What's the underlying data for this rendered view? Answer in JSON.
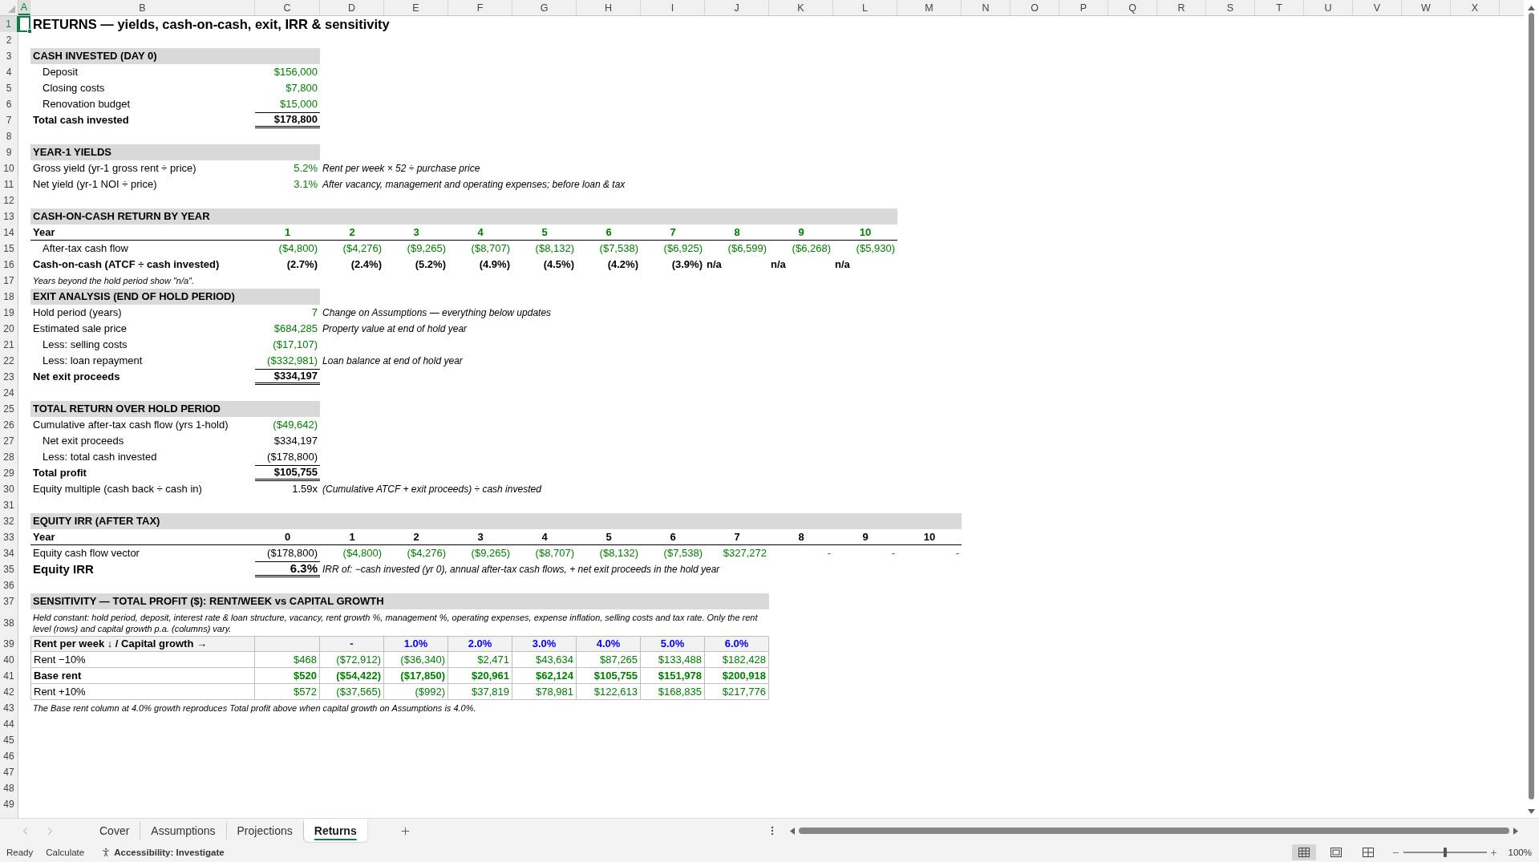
{
  "columns": [
    {
      "label": "A",
      "selected": true
    },
    {
      "label": "B",
      "selected": false
    },
    {
      "label": "C",
      "selected": false
    },
    {
      "label": "D",
      "selected": false
    },
    {
      "label": "E",
      "selected": false
    },
    {
      "label": "F",
      "selected": false
    },
    {
      "label": "G",
      "selected": false
    },
    {
      "label": "H",
      "selected": false
    },
    {
      "label": "I",
      "selected": false
    },
    {
      "label": "J",
      "selected": false
    },
    {
      "label": "K",
      "selected": false
    },
    {
      "label": "L",
      "selected": false
    },
    {
      "label": "M",
      "selected": false
    },
    {
      "label": "N",
      "selected": false
    },
    {
      "label": "O",
      "selected": false
    },
    {
      "label": "P",
      "selected": false
    },
    {
      "label": "Q",
      "selected": false
    },
    {
      "label": "R",
      "selected": false
    },
    {
      "label": "S",
      "selected": false
    },
    {
      "label": "T",
      "selected": false
    },
    {
      "label": "U",
      "selected": false
    },
    {
      "label": "V",
      "selected": false
    },
    {
      "label": "W",
      "selected": false
    },
    {
      "label": "X",
      "selected": false
    }
  ],
  "row_numbers": [
    {
      "label": "1",
      "selected": true
    },
    {
      "label": "2",
      "selected": false
    },
    {
      "label": "3",
      "selected": false
    },
    {
      "label": "4",
      "selected": false
    },
    {
      "label": "5",
      "selected": false
    },
    {
      "label": "6",
      "selected": false
    },
    {
      "label": "7",
      "selected": false
    },
    {
      "label": "8",
      "selected": false
    },
    {
      "label": "9",
      "selected": false
    },
    {
      "label": "10",
      "selected": false
    },
    {
      "label": "11",
      "selected": false
    },
    {
      "label": "12",
      "selected": false
    },
    {
      "label": "13",
      "selected": false
    },
    {
      "label": "14",
      "selected": false
    },
    {
      "label": "15",
      "selected": false
    },
    {
      "label": "16",
      "selected": false
    },
    {
      "label": "17",
      "selected": false
    },
    {
      "label": "18",
      "selected": false
    },
    {
      "label": "19",
      "selected": false
    },
    {
      "label": "20",
      "selected": false
    },
    {
      "label": "21",
      "selected": false
    },
    {
      "label": "22",
      "selected": false
    },
    {
      "label": "23",
      "selected": false
    },
    {
      "label": "24",
      "selected": false
    },
    {
      "label": "25",
      "selected": false
    },
    {
      "label": "26",
      "selected": false
    },
    {
      "label": "27",
      "selected": false
    },
    {
      "label": "28",
      "selected": false
    },
    {
      "label": "29",
      "selected": false
    },
    {
      "label": "30",
      "selected": false
    },
    {
      "label": "31",
      "selected": false
    },
    {
      "label": "32",
      "selected": false
    },
    {
      "label": "33",
      "selected": false
    },
    {
      "label": "34",
      "selected": false
    },
    {
      "label": "35",
      "selected": false
    },
    {
      "label": "36",
      "selected": false
    },
    {
      "label": "37",
      "selected": false
    },
    {
      "label": "38",
      "selected": false
    },
    {
      "label": "39",
      "selected": false
    },
    {
      "label": "40",
      "selected": false
    },
    {
      "label": "41",
      "selected": false
    },
    {
      "label": "42",
      "selected": false
    },
    {
      "label": "43",
      "selected": false
    },
    {
      "label": "44",
      "selected": false
    },
    {
      "label": "45",
      "selected": false
    },
    {
      "label": "46",
      "selected": false
    },
    {
      "label": "47",
      "selected": false
    },
    {
      "label": "48",
      "selected": false
    },
    {
      "label": "49",
      "selected": false
    }
  ],
  "title": "RETURNS — yields, cash-on-cash, exit, IRR & sensitivity",
  "cash_invested": {
    "heading": "CASH INVESTED (DAY 0)",
    "lines": [
      {
        "kind": "sub",
        "label": "Deposit",
        "value": "$156,000",
        "color": "#008000"
      },
      {
        "kind": "sub",
        "label": "Closing costs",
        "value": "$7,800",
        "color": "#008000"
      },
      {
        "kind": "sub",
        "label": "Renovation budget",
        "value": "$15,000",
        "color": "#008000"
      },
      {
        "kind": "total",
        "label": "Total cash invested",
        "value": "$178,800",
        "color": "#000000"
      }
    ]
  },
  "year1_yields": {
    "heading": "YEAR-1 YIELDS",
    "lines": [
      {
        "kind": "item",
        "label": "Gross yield (yr-1 gross rent ÷ price)",
        "value": "5.2%",
        "color": "#008000",
        "note": "Rent per week × 52 ÷ purchase price"
      },
      {
        "kind": "item",
        "label": "Net yield (yr-1 NOI ÷ price)",
        "value": "3.1%",
        "color": "#008000",
        "note": "After vacancy, management and operating expenses; before loan & tax"
      }
    ]
  },
  "cash_on_cash": {
    "heading": "CASH-ON-CASH RETURN BY YEAR",
    "year_label": "Year",
    "years": [
      "1",
      "2",
      "3",
      "4",
      "5",
      "6",
      "7",
      "8",
      "9",
      "10"
    ],
    "after_tax_cash_flow": {
      "label": "After-tax cash flow",
      "values": [
        "($4,800)",
        "($4,276)",
        "($9,265)",
        "($8,707)",
        "($8,132)",
        "($7,538)",
        "($6,925)",
        "($6,599)",
        "($6,268)",
        "($5,930)"
      ]
    },
    "cash_on_cash_return": {
      "label": "Cash-on-cash (ATCF ÷ cash invested)",
      "values": [
        "(2.7%)",
        "(2.4%)",
        "(5.2%)",
        "(4.9%)",
        "(4.5%)",
        "(4.2%)",
        "(3.9%)"
      ],
      "beyond_hold": [
        "n/a",
        "n/a",
        "n/a"
      ]
    },
    "footnote": "Years beyond the hold period show \"n/a\"."
  },
  "exit_analysis": {
    "heading": "EXIT ANALYSIS (END OF HOLD PERIOD)",
    "lines": [
      {
        "kind": "item",
        "label": "Hold period (years)",
        "value": "7",
        "color": "#008000",
        "note": "Change on Assumptions — everything below updates"
      },
      {
        "kind": "item",
        "label": "Estimated sale price",
        "value": "$684,285",
        "color": "#008000",
        "note": "Property value at end of hold year"
      },
      {
        "kind": "sub",
        "label": "Less: selling costs",
        "value": "($17,107)",
        "color": "#008000"
      },
      {
        "kind": "sub",
        "label": "Less: loan repayment",
        "value": "($332,981)",
        "color": "#008000",
        "note": "Loan balance at end of hold year"
      },
      {
        "kind": "total",
        "label": "Net exit proceeds",
        "value": "$334,197",
        "color": "#000000"
      }
    ]
  },
  "total_return": {
    "heading": "TOTAL RETURN OVER HOLD PERIOD",
    "lines": [
      {
        "kind": "item",
        "label": "Cumulative after-tax cash flow (yrs 1-hold)",
        "value": "($49,642)",
        "color": "#008000"
      },
      {
        "kind": "sub",
        "label": "Net exit proceeds",
        "value": "$334,197",
        "color": "#000000"
      },
      {
        "kind": "sub",
        "label": "Less: total cash invested",
        "value": "($178,800)",
        "color": "#000000"
      },
      {
        "kind": "total",
        "label": "Total profit",
        "value": "$105,755",
        "color": "#000000"
      },
      {
        "kind": "item",
        "label": "Equity multiple (cash back ÷ cash in)",
        "value": "1.59x",
        "color": "#000000",
        "note": "(Cumulative ATCF + exit proceeds) ÷ cash invested"
      }
    ]
  },
  "equity_irr": {
    "heading": "EQUITY IRR (AFTER TAX)",
    "year_label": "Year",
    "years": [
      "0",
      "1",
      "2",
      "3",
      "4",
      "5",
      "6",
      "7",
      "8",
      "9",
      "10"
    ],
    "cash_flow_vector": {
      "label": "Equity cash flow vector",
      "initial": "($178,800)",
      "values": [
        "($4,800)",
        "($4,276)",
        "($9,265)",
        "($8,707)",
        "($8,132)",
        "($7,538)",
        "$327,272"
      ],
      "beyond_hold": [
        "-",
        "-",
        "-"
      ]
    },
    "irr": {
      "label": "Equity IRR",
      "value": "6.3%",
      "note": "IRR of: −cash invested (yr 0), annual after-tax cash flows, + net exit proceeds in the hold year"
    }
  },
  "sensitivity": {
    "heading": "SENSITIVITY — TOTAL PROFIT ($): RENT/WEEK vs CAPITAL GROWTH",
    "description": "Held constant: hold period, deposit, interest rate & loan structure, vacancy, rent growth %, management %, operating expenses, expense inflation, selling costs and tax rate. Only the rent level (rows) and capital growth p.a. (columns) vary.",
    "corner_label": "Rent per week ↓ / Capital growth →",
    "growth_rates": [
      "-",
      "1.0%",
      "2.0%",
      "3.0%",
      "4.0%",
      "5.0%",
      "6.0%"
    ],
    "rows": [
      {
        "label": "Rent −10%",
        "rent": "$468",
        "values": [
          "($72,912)",
          "($36,340)",
          "$2,471",
          "$43,634",
          "$87,265",
          "$133,488",
          "$182,428"
        ],
        "base_case": false
      },
      {
        "label": "Base rent",
        "rent": "$520",
        "values": [
          "($54,422)",
          "($17,850)",
          "$20,961",
          "$62,124",
          "$105,755",
          "$151,978",
          "$200,918"
        ],
        "base_case": true
      },
      {
        "label": "Rent +10%",
        "rent": "$572",
        "values": [
          "($37,565)",
          "($992)",
          "$37,819",
          "$78,981",
          "$122,613",
          "$168,835",
          "$217,776"
        ],
        "base_case": false
      }
    ],
    "footnote": "The Base rent column at 4.0% growth reproduces Total profit above when capital growth on Assumptions is 4.0%."
  },
  "sheet_tabs": [
    {
      "label": "Cover",
      "selected": false
    },
    {
      "label": "Assumptions",
      "selected": false
    },
    {
      "label": "Projections",
      "selected": false
    },
    {
      "label": "Returns",
      "selected": true
    }
  ],
  "status_bar": {
    "mode": "Ready",
    "calculate": "Calculate",
    "accessibility": "Accessibility: Investigate",
    "views": [
      {
        "kind": "normal",
        "selected": true
      },
      {
        "kind": "page_layout",
        "selected": false
      },
      {
        "kind": "page_break",
        "selected": false
      }
    ],
    "zoom": {
      "level": 0.5,
      "label": "100%"
    }
  }
}
